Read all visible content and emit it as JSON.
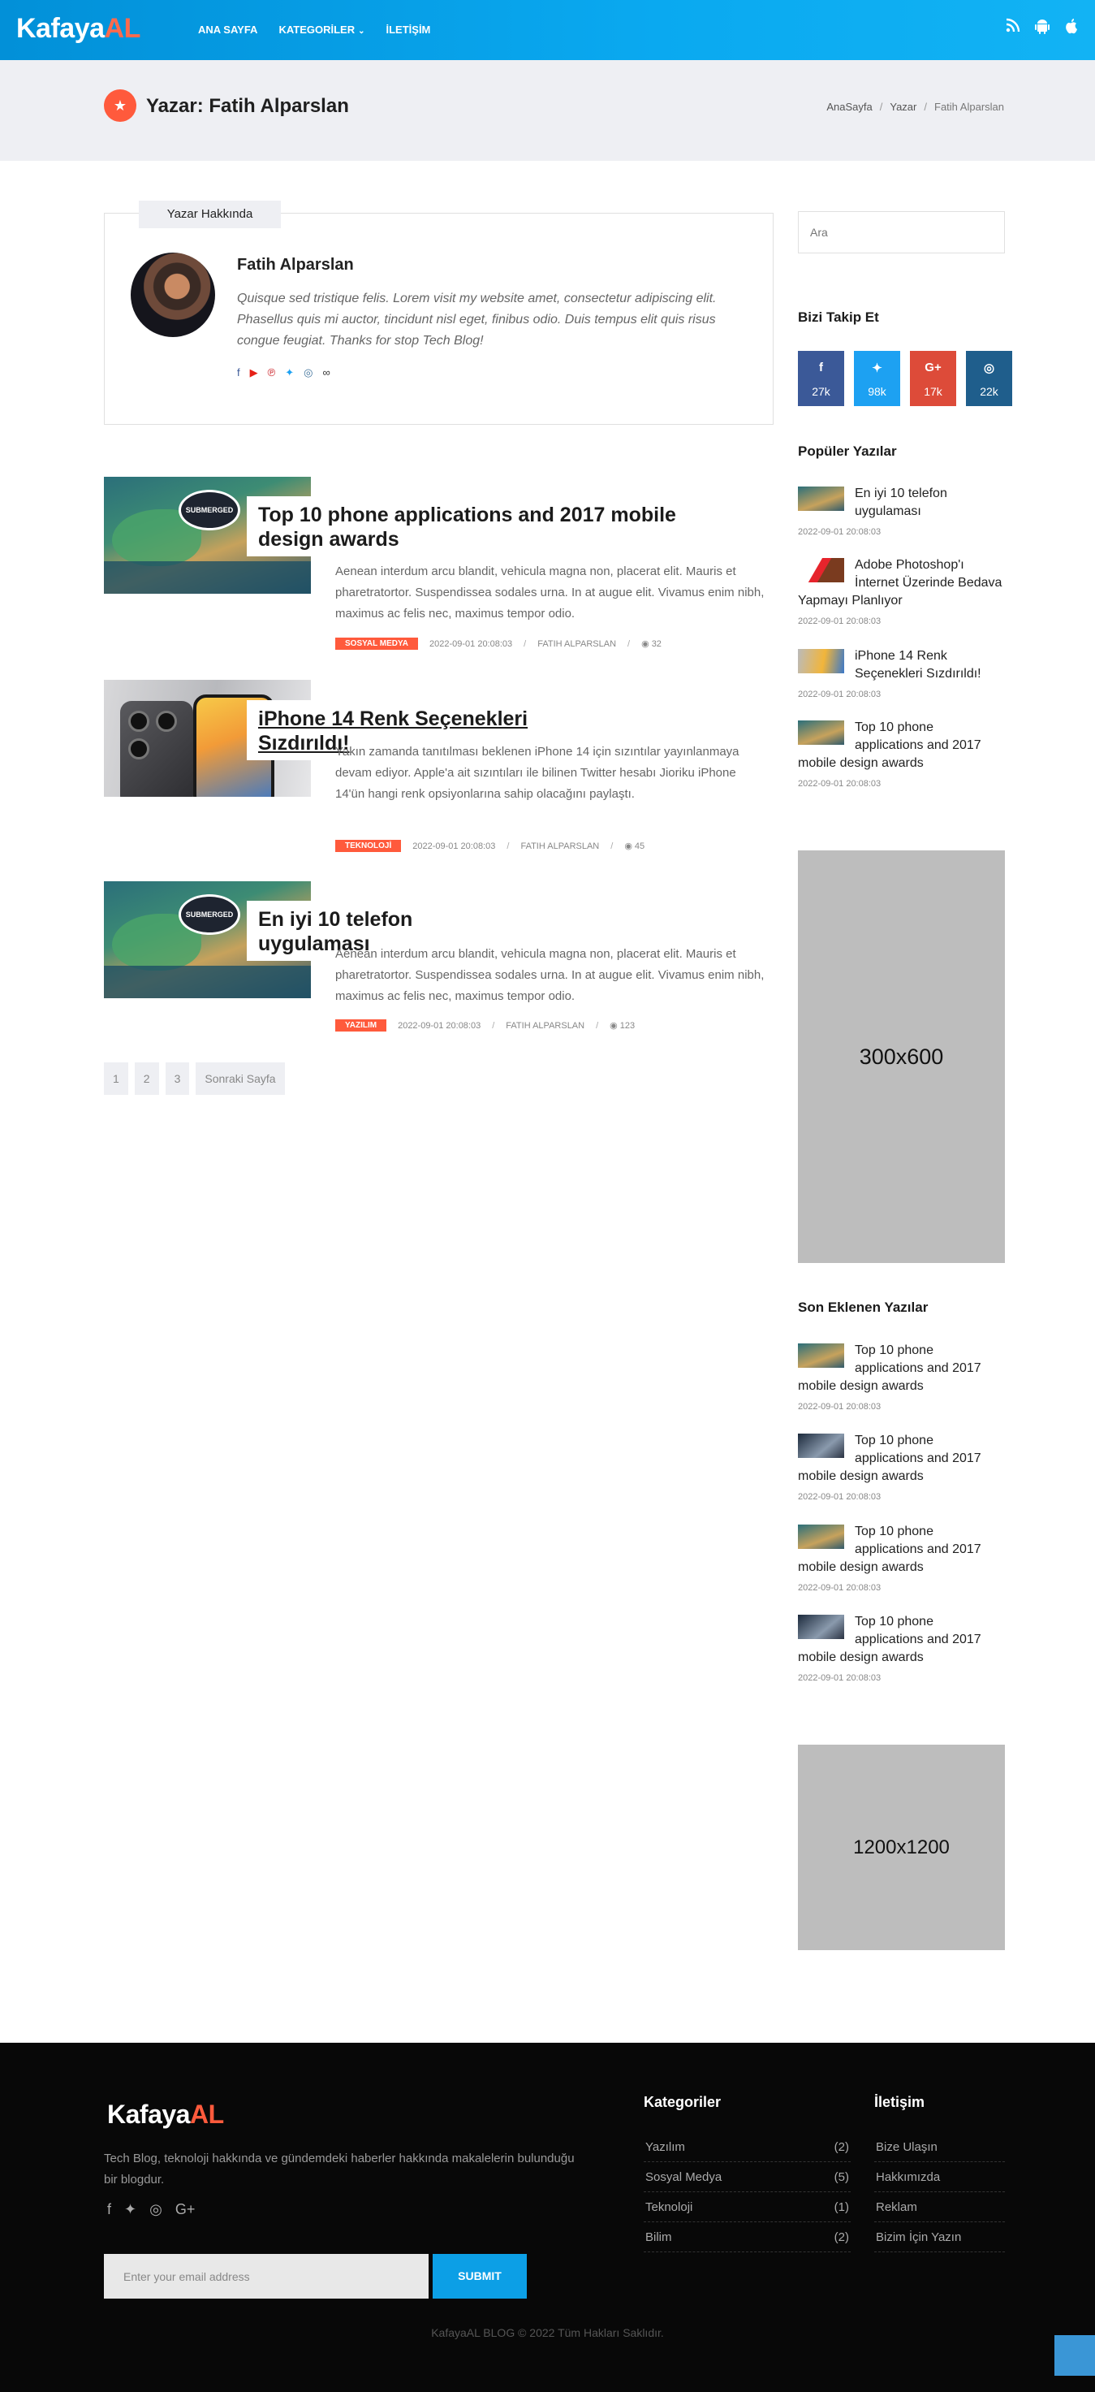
{
  "brand": {
    "name_main": "Kafaya",
    "name_accent": "AL"
  },
  "nav": {
    "home": "ANA SAYFA",
    "categories": "KATEGORİLER",
    "categories_chevron": "⌄",
    "contact": "İLETİŞİM"
  },
  "header_icons": [
    "rss-icon",
    "android-icon",
    "apple-icon"
  ],
  "page": {
    "title": "Yazar: Fatih Alparslan",
    "badge_icon": "★"
  },
  "breadcrumb": {
    "home": "AnaSayfa",
    "sep": "/",
    "section": "Yazar",
    "current": "Fatih Alparslan"
  },
  "author": {
    "tab_label": "Yazar Hakkında",
    "name": "Fatih Alparslan",
    "bio": "Quisque sed tristique felis. Lorem visit my website amet, consectetur adipiscing elit. Phasellus quis mi auctor, tincidunt nisl eget, finibus odio. Duis tempus elit quis risus congue feugiat. Thanks for stop Tech Blog!",
    "social": [
      {
        "icon": "facebook-icon",
        "glyph": "f",
        "color": "#3b5998"
      },
      {
        "icon": "youtube-icon",
        "glyph": "▶",
        "color": "#e62117"
      },
      {
        "icon": "pinterest-icon",
        "glyph": "℗",
        "color": "#cb2027"
      },
      {
        "icon": "twitter-icon",
        "glyph": "✦",
        "color": "#1da1f2"
      },
      {
        "icon": "instagram-icon",
        "glyph": "◎",
        "color": "#3f729b"
      },
      {
        "icon": "link-icon",
        "glyph": "∞",
        "color": "#333333"
      }
    ]
  },
  "posts": [
    {
      "title": "Top 10 phone applications and 2017 mobile design awards",
      "excerpt": "Aenean interdum arcu blandit, vehicula magna non, placerat elit. Mauris et pharetratortor. Suspendissea sodales urna. In at augue elit. Vivamus enim nibh, maximus ac felis nec, maximus tempor odio.",
      "category": "SOSYAL MEDYA",
      "date": "2022-09-01 20:08:03",
      "author": "FATIH ALPARSLAN",
      "views": "32",
      "bubble": "SUBMERGED"
    },
    {
      "title": "iPhone 14 Renk Seçenekleri Sızdırıldı!",
      "excerpt": "Yakın zamanda tanıtılması beklenen iPhone 14 için sızıntılar yayınlanmaya devam ediyor. Apple'a ait sızıntıları ile bilinen Twitter hesabı Jioriku iPhone 14'ün hangi renk opsiyonlarına sahip olacağını paylaştı.",
      "category": "TEKNOLOJİ",
      "date": "2022-09-01 20:08:03",
      "author": "FATIH ALPARSLAN",
      "views": "45"
    },
    {
      "title": "En iyi 10 telefon uygulaması",
      "excerpt": "Aenean interdum arcu blandit, vehicula magna non, placerat elit. Mauris et pharetratortor. Suspendissea sodales urna. In at augue elit. Vivamus enim nibh, maximus ac felis nec, maximus tempor odio.",
      "category": "YAZILIM",
      "date": "2022-09-01 20:08:03",
      "author": "FATIH ALPARSLAN",
      "views": "123",
      "bubble": "SUBMERGED"
    }
  ],
  "meta_sep": "/",
  "eye_icon": "◉",
  "pagination": {
    "pages": [
      "1",
      "2",
      "3"
    ],
    "next": "Sonraki Sayfa"
  },
  "sidebar": {
    "search_placeholder": "Ara",
    "follow_title": "Bizi Takip Et",
    "follow": [
      {
        "icon": "facebook-icon",
        "glyph": "f",
        "count": "27k",
        "color": "#3b5998"
      },
      {
        "icon": "twitter-icon",
        "glyph": "✦",
        "count": "98k",
        "color": "#1da1f2"
      },
      {
        "icon": "google-plus-icon",
        "glyph": "G+",
        "count": "17k",
        "color": "#dd4b39"
      },
      {
        "icon": "instagram-icon",
        "glyph": "◎",
        "count": "22k",
        "color": "#1f5e8c"
      }
    ],
    "popular_title": "Popüler Yazılar",
    "popular": [
      {
        "title": "En iyi 10 telefon uygulaması",
        "date": "2022-09-01 20:08:03"
      },
      {
        "title": "Adobe Photoshop'ı İnternet Üzerinde Bedava Yapmayı Planlıyor",
        "date": "2022-09-01 20:08:03"
      },
      {
        "title": "iPhone 14 Renk Seçenekleri Sızdırıldı!",
        "date": "2022-09-01 20:08:03"
      },
      {
        "title": "Top 10 phone applications and 2017 mobile design awards",
        "date": "2022-09-01 20:08:03"
      }
    ],
    "ad1": "300x600",
    "recent_title": "Son Eklenen Yazılar",
    "recent": [
      {
        "title": "Top 10 phone applications and 2017 mobile design awards",
        "date": "2022-09-01 20:08:03"
      },
      {
        "title": "Top 10 phone applications and 2017 mobile design awards",
        "date": "2022-09-01 20:08:03"
      },
      {
        "title": "Top 10 phone applications and 2017 mobile design awards",
        "date": "2022-09-01 20:08:03"
      },
      {
        "title": "Top 10 phone applications and 2017 mobile design awards",
        "date": "2022-09-01 20:08:03"
      }
    ],
    "ad2": "1200x1200"
  },
  "footer": {
    "description": "Tech Blog, teknoloji hakkında ve gündemdeki haberler hakkında makalelerin bulunduğu bir blogdur.",
    "social": [
      {
        "icon": "facebook-icon",
        "glyph": "f"
      },
      {
        "icon": "twitter-icon",
        "glyph": "✦"
      },
      {
        "icon": "instagram-icon",
        "glyph": "◎"
      },
      {
        "icon": "google-plus-icon",
        "glyph": "G+"
      }
    ],
    "email_placeholder": "Enter your email address",
    "submit": "SUBMIT",
    "categories_title": "Kategoriler",
    "categories": [
      {
        "name": "Yazılım",
        "count": "(2)"
      },
      {
        "name": "Sosyal Medya",
        "count": "(5)"
      },
      {
        "name": "Teknoloji",
        "count": "(1)"
      },
      {
        "name": "Bilim",
        "count": "(2)"
      }
    ],
    "contact_title": "İletişim",
    "contact": [
      "Bize Ulaşın",
      "Hakkımızda",
      "Reklam",
      "Bizim İçin Yazın"
    ],
    "copyright": "KafayaAL BLOG © 2022 Tüm Hakları Saklıdır."
  },
  "colors": {
    "header_blue": "#0aa9f0",
    "accent": "#ff5a3c",
    "footer_bg": "#080808"
  }
}
